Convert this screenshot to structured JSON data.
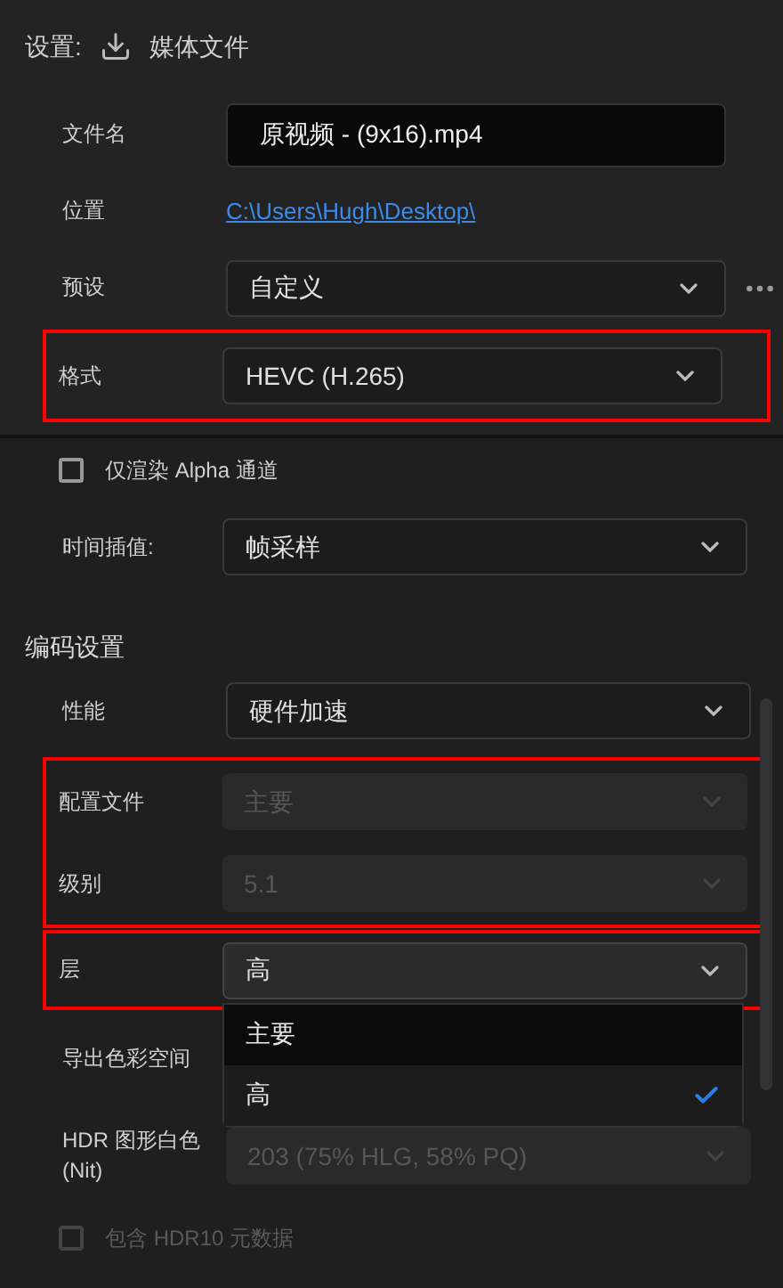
{
  "header": {
    "label": "设置:",
    "title": "媒体文件"
  },
  "file_groups": [
    {
      "highlighted": false,
      "rows": [
        {
          "kind": "input",
          "label": "文件名",
          "value": "原视频 - (9x16).mp4"
        },
        {
          "kind": "link",
          "label": "位置",
          "value": "C:\\Users\\Hugh\\Desktop\\"
        },
        {
          "kind": "select",
          "label": "预设",
          "value": "自定义",
          "more": true
        }
      ]
    },
    {
      "highlighted": true,
      "rows": [
        {
          "kind": "select",
          "label": "格式",
          "value": "HEVC (H.265)"
        }
      ]
    }
  ],
  "alpha_checkbox": {
    "label": "仅渲染 Alpha 通道",
    "checked": false,
    "disabled": false
  },
  "time_interpolation": {
    "kind": "select",
    "label": "时间插值:",
    "value": "帧采样"
  },
  "encoding": {
    "title": "编码设置",
    "groups": [
      {
        "highlighted": false,
        "rows": [
          {
            "kind": "select",
            "label": "性能",
            "value": "硬件加速"
          }
        ]
      },
      {
        "highlighted": true,
        "rows": [
          {
            "kind": "select",
            "label": "配置文件",
            "value": "主要",
            "disabled": true
          },
          {
            "kind": "select",
            "label": "级别",
            "value": "5.1",
            "disabled": true
          }
        ]
      },
      {
        "highlighted": true,
        "rows": [
          {
            "kind": "select",
            "label": "层",
            "value": "高",
            "expanded": true,
            "options": [
              {
                "label": "主要",
                "selected": false
              },
              {
                "label": "高",
                "selected": true
              }
            ]
          }
        ]
      },
      {
        "highlighted": false,
        "rows": [
          {
            "kind": "covered",
            "label": "导出色彩空间"
          },
          {
            "kind": "select",
            "label": "HDR 图形白色 (Nit)",
            "value": "203 (75% HLG, 58% PQ)",
            "disabled": true
          }
        ]
      }
    ]
  },
  "hdr10_checkbox": {
    "label": "包含 HDR10 元数据",
    "checked": false,
    "disabled": true
  }
}
